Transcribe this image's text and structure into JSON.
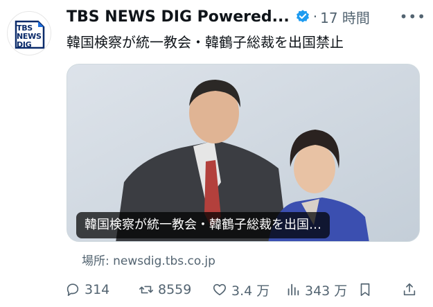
{
  "post": {
    "author_name": "TBS NEWS DIG Powered...",
    "separator": "·",
    "time_ago": "17 時間",
    "more_label": "•••",
    "text": "韓国検察が統一教会・韓鶴子総裁を出国禁止"
  },
  "avatar": {
    "logo_line1": "TBS",
    "logo_line2": "NEWS",
    "logo_line3": "DIG",
    "brand_color": "#0b2b6a",
    "accent_color": "#1d6fe0"
  },
  "card": {
    "caption": "韓国検察が統一教会・韓鶴子総裁を出国…",
    "source": "場所: newsdig.tbs.co.jp"
  },
  "actions": {
    "replies": "314",
    "reposts": "8559",
    "likes": "3.4 万",
    "views": "343 万"
  },
  "colors": {
    "verified": "#1d9bf0",
    "muted_text": "#536471"
  },
  "icons": [
    "verified-badge-icon",
    "reply-icon",
    "repost-icon",
    "like-icon",
    "views-icon",
    "bookmark-icon",
    "share-icon"
  ]
}
